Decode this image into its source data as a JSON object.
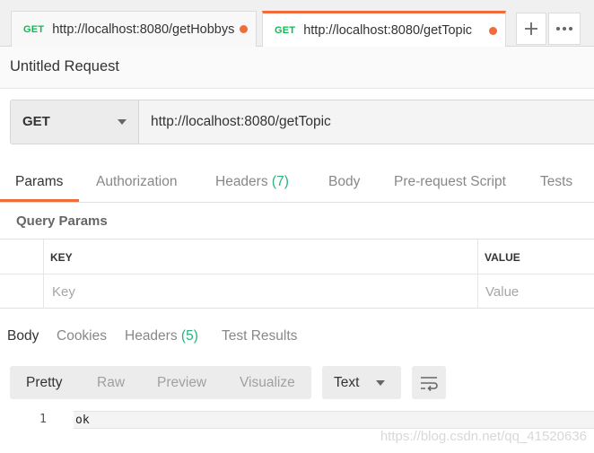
{
  "tabs": [
    {
      "method": "GET",
      "url": "http://localhost:8080/getHobbys",
      "unsaved": true
    },
    {
      "method": "GET",
      "url": "http://localhost:8080/getTopic",
      "unsaved": true,
      "active": true
    }
  ],
  "tab_actions": {
    "new_tab_icon": "plus-icon",
    "more_icon": "more-horizontal-icon"
  },
  "request": {
    "name": "Untitled Request",
    "method": "GET",
    "url": "http://localhost:8080/getTopic"
  },
  "request_tabs": {
    "params": "Params",
    "authorization": "Authorization",
    "headers": "Headers",
    "headers_count": "(7)",
    "body": "Body",
    "pre_request_script": "Pre-request Script",
    "tests": "Tests",
    "active": "Params"
  },
  "query_params": {
    "title": "Query Params",
    "columns": {
      "key": "KEY",
      "value": "VALUE"
    },
    "placeholders": {
      "key": "Key",
      "value": "Value"
    }
  },
  "response_tabs": {
    "body": "Body",
    "cookies": "Cookies",
    "headers": "Headers",
    "headers_count": "(5)",
    "test_results": "Test Results",
    "active": "Body"
  },
  "response_toolbar": {
    "pretty": "Pretty",
    "raw": "Raw",
    "preview": "Preview",
    "visualize": "Visualize",
    "format": "Text",
    "wrap_icon": "wrap-lines-icon"
  },
  "response_body": {
    "lines": [
      {
        "number": "1",
        "text": "ok"
      }
    ]
  },
  "watermark": "https://blog.csdn.net/qq_41520636",
  "colors": {
    "accent": "#f26b3a",
    "get_method": "#0cbb52",
    "count": "#26b47f"
  }
}
